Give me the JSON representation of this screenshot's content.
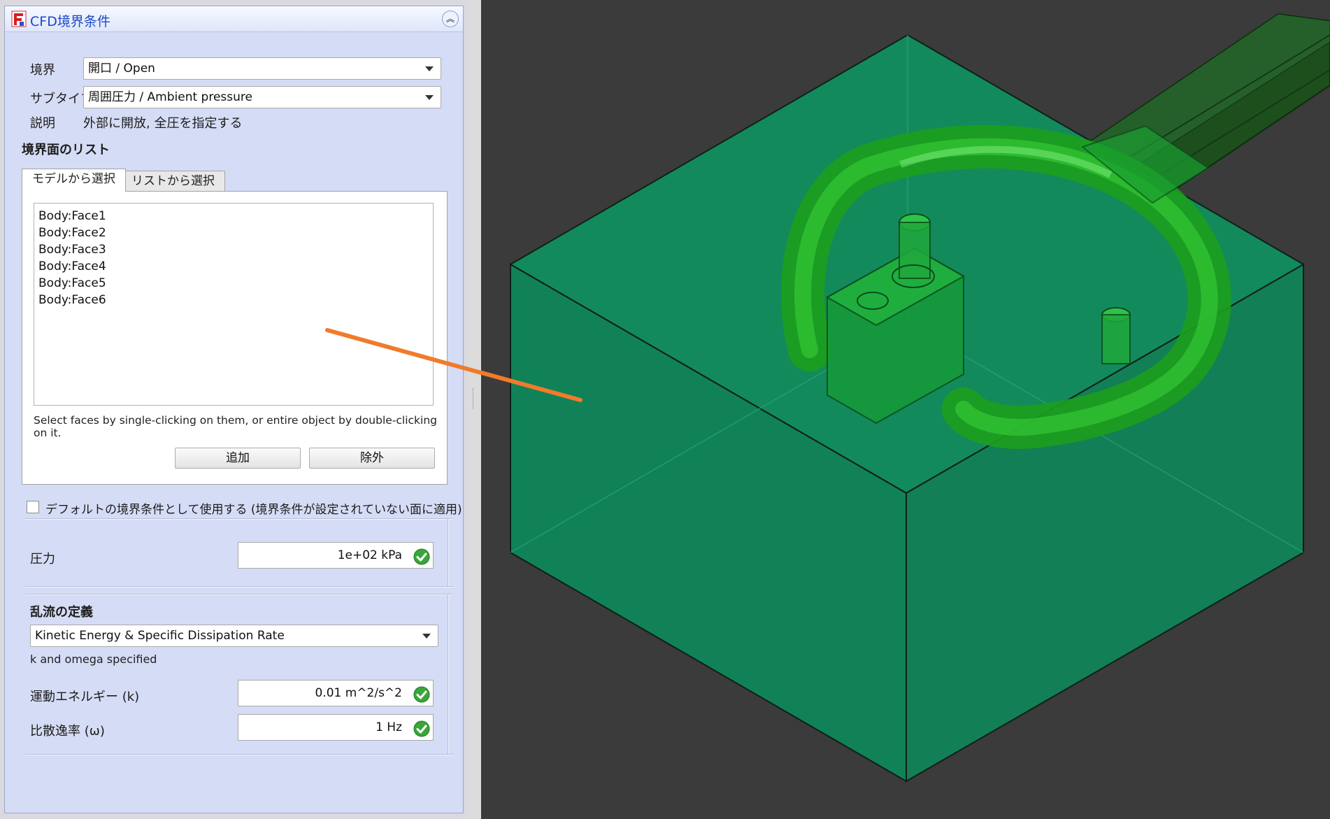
{
  "panel": {
    "title": "CFD境界条件",
    "boundary_label": "境界",
    "boundary_value": "開口 / Open",
    "subtype_label": "サブタイプ",
    "subtype_value": "周囲圧力 / Ambient pressure",
    "description_label": "説明",
    "description_value": "外部に開放, 全圧を指定する",
    "face_list_heading": "境界面のリスト",
    "tabs": [
      {
        "label": "モデルから選択"
      },
      {
        "label": "リストから選択"
      }
    ],
    "faces": [
      "Body:Face1",
      "Body:Face2",
      "Body:Face3",
      "Body:Face4",
      "Body:Face5",
      "Body:Face6"
    ],
    "hint": "Select faces by single-clicking on them, or entire object by double-clicking on it.",
    "add_button": "追加",
    "remove_button": "除外",
    "default_checkbox_label": "デフォルトの境界条件として使用する (境界条件が設定されていない面に適用)",
    "default_checked": false,
    "pressure_label": "圧力",
    "pressure_value": "1e+02 kPa",
    "turbulence_heading": "乱流の定義",
    "turbulence_model": "Kinetic Energy & Specific Dissipation Rate",
    "turbulence_note": "k and omega specified",
    "k_label": "運動エネルギー (k)",
    "k_value": "0.01 m^2/s^2",
    "omega_label": "比散逸率 (ω)",
    "omega_value": "1 Hz"
  },
  "icons": {
    "logo": "freecad-logo-icon",
    "collapse": "collapse-up-icon",
    "dropdown": "chevron-down-icon",
    "valid": "check-circle-icon"
  },
  "colors": {
    "panel_bg": "#d5dcf5",
    "title_text": "#1b48c9",
    "domain_box": "#12855a",
    "geometry": "#22b822",
    "annotation_arrow": "#f07b2a",
    "viewport_bg": "#3b3b3b"
  }
}
